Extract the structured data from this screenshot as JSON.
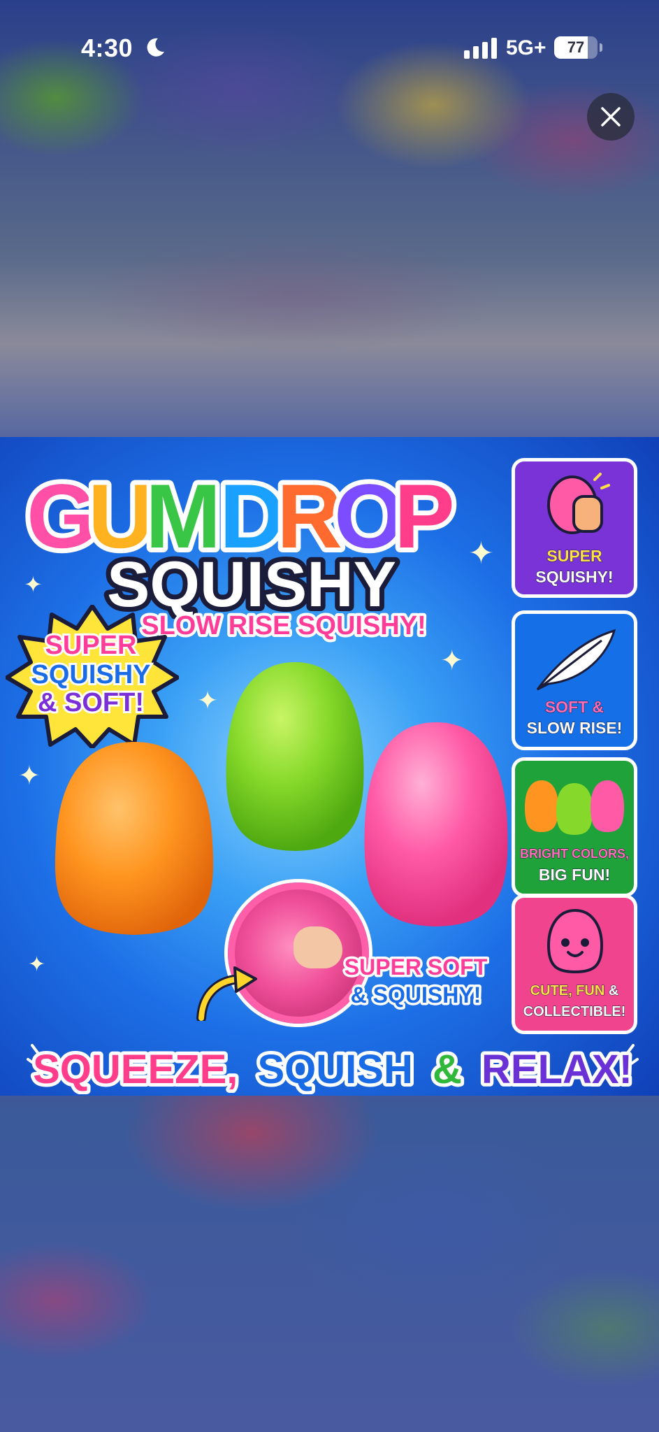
{
  "status_bar": {
    "time": "4:30",
    "network": "5G+",
    "battery": "77",
    "battery_level": 0.77,
    "icons": [
      "moon-icon",
      "signal-icon",
      "battery-icon"
    ]
  },
  "viewer": {
    "close_icon": "close-icon"
  },
  "product_image": {
    "title_line1_letters": [
      "G",
      "U",
      "M",
      "D",
      "R",
      "O",
      "P"
    ],
    "title_line1_colors": [
      "#ff4fa6",
      "#ffb21f",
      "#39c646",
      "#1aa1ff",
      "#ff6b2f",
      "#7b4dff",
      "#ff3d8b"
    ],
    "title_line2": "SQUISHY",
    "subtitle": "SLOW RISE SQUISHY!",
    "burst_line1": "SUPER",
    "burst_line2": "SQUISHY",
    "burst_line3": "& SOFT!",
    "bubble_caption_line1": "SUPER SOFT",
    "bubble_caption_line2": "& SQUISHY!",
    "slogan_part1": "SQUEEZE,",
    "slogan_part2": "SQUISH",
    "slogan_part3": "&",
    "slogan_part4": "RELAX!",
    "cards": [
      {
        "line1": "SUPER",
        "line2": "SQUISHY!",
        "color": "#7a33d6",
        "icon": "squeeze-hand-icon"
      },
      {
        "line1": "SOFT &",
        "line2": "SLOW RISE!",
        "color": "#1570e8",
        "icon": "feather-icon"
      },
      {
        "line1": "BRIGHT COLORS,",
        "line2": "BIG FUN!",
        "color": "#1fa23a",
        "icon": "three-gumdrops-icon"
      },
      {
        "line1a": "CUTE,",
        "line1b": "FUN",
        "line1c": "&",
        "line2": "COLLECTIBLE!",
        "color": "#f0448f",
        "icon": "smiling-gumdrop-icon"
      }
    ],
    "colors": {
      "orange": "#ff8a1a",
      "green": "#7ed321",
      "pink": "#ff4a9a"
    }
  }
}
